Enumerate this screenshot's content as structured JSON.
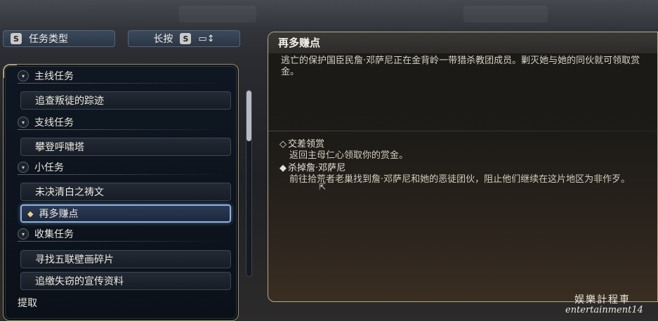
{
  "toolbar": {
    "category_key": "S",
    "category_label": "任务类型",
    "longpress_label": "长按",
    "longpress_key": "S",
    "sort_icon": "sort-icon"
  },
  "list": {
    "categories": [
      {
        "label": "主线任务",
        "items": [
          "追查叛徒的踪迹"
        ]
      },
      {
        "label": "支线任务",
        "items": [
          "攀登呼啸塔"
        ]
      },
      {
        "label": "小任务",
        "items": [
          "未决清白之祷文",
          "再多赚点"
        ]
      },
      {
        "label": "收集任务",
        "items": [
          "寻找五联壁画碎片",
          "追缴失窃的宣传资料"
        ]
      }
    ],
    "selected": "再多赚点",
    "partial_item": "提取"
  },
  "detail": {
    "title": "再多赚点",
    "description": "逃亡的保护国臣民詹·邓萨尼正在金背岭一带猎杀教团成员。剿灭她与她的同伙就可领取赏金。",
    "objectives": [
      {
        "title": "交差领赏",
        "text": "返回主母仁心领取你的赏金。",
        "done": false
      },
      {
        "title": "杀掉詹·邓萨尼",
        "text": "前往拾荒者老巢找到詹·邓萨尼和她的恶徒团伙，阻止他们继续在这片地区为非作歹。",
        "done": true
      }
    ]
  },
  "watermark": {
    "line1": "娱樂計程車",
    "line2": "entertainment14"
  }
}
